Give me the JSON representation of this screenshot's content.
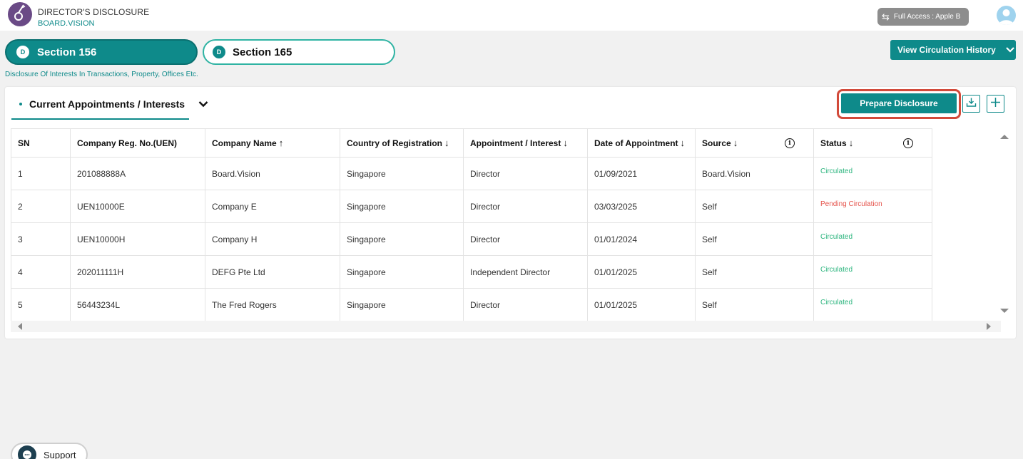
{
  "app": {
    "title": "DIRECTOR'S DISCLOSURE",
    "subtitle": "BOARD.VISION",
    "access_label": "Full Access : Apple B"
  },
  "tabs": [
    {
      "badge": "D",
      "label": "Section 156",
      "active": true
    },
    {
      "badge": "D",
      "label": "Section 165",
      "active": false
    }
  ],
  "page_subtitle": "Disclosure Of Interests In Transactions, Property, Offices Etc.",
  "view_history_label": "View Circulation History",
  "section": {
    "tab_label": "Current Appointments / Interests",
    "prepare_label": "Prepare Disclosure",
    "download_icon": "download-icon",
    "add_icon": "plus-icon"
  },
  "table": {
    "columns": [
      {
        "label": "SN",
        "sort": ""
      },
      {
        "label": "Company Reg. No.(UEN)",
        "sort": ""
      },
      {
        "label": "Company Name",
        "sort": "↑"
      },
      {
        "label": "Country of Registration",
        "sort": "↓"
      },
      {
        "label": "Appointment / Interest",
        "sort": "↓"
      },
      {
        "label": "Date of Appointment",
        "sort": "↓"
      },
      {
        "label": "Source",
        "sort": "↓"
      },
      {
        "label": "Status",
        "sort": "↓"
      }
    ],
    "rows": [
      {
        "sn": "1",
        "uen": "201088888A",
        "company": "Board.Vision",
        "country": "Singapore",
        "appointment": "Director",
        "date": "01/09/2021",
        "source": "Board.Vision",
        "status": "Circulated"
      },
      {
        "sn": "2",
        "uen": "UEN10000E",
        "company": "Company E",
        "country": "Singapore",
        "appointment": "Director",
        "date": "03/03/2025",
        "source": "Self",
        "status": "Pending Circulation"
      },
      {
        "sn": "3",
        "uen": "UEN10000H",
        "company": "Company H",
        "country": "Singapore",
        "appointment": "Director",
        "date": "01/01/2024",
        "source": "Self",
        "status": "Circulated"
      },
      {
        "sn": "4",
        "uen": "202011111H",
        "company": "DEFG Pte Ltd",
        "country": "Singapore",
        "appointment": "Independent Director",
        "date": "01/01/2025",
        "source": "Self",
        "status": "Circulated"
      },
      {
        "sn": "5",
        "uen": "56443234L",
        "company": "The Fred Rogers",
        "country": "Singapore",
        "appointment": "Director",
        "date": "01/01/2025",
        "source": "Self",
        "status": "Circulated"
      }
    ]
  },
  "colors": {
    "accent": "#0e8a8a",
    "status_circulated": "#2cb57e",
    "status_pending": "#e5534b",
    "highlight": "#d24a3a"
  },
  "support_label": "Support"
}
